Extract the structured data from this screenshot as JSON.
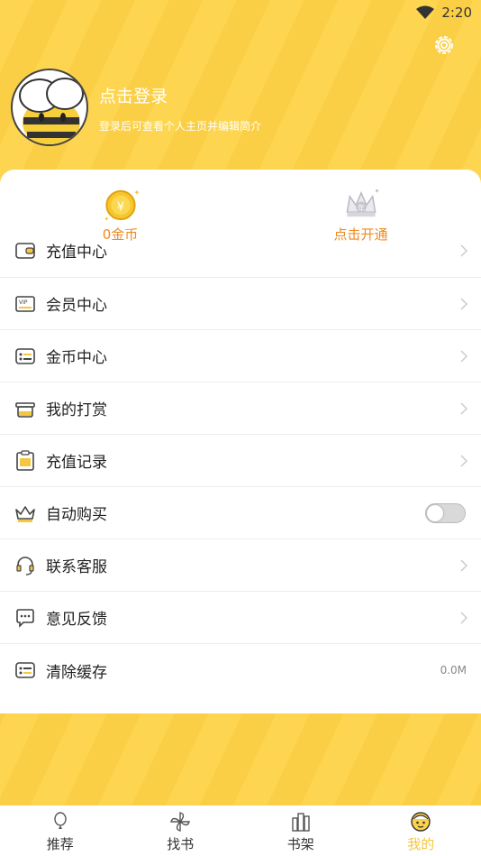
{
  "status_bar": {
    "time": "2:20"
  },
  "profile": {
    "login_title": "点击登录",
    "login_subtitle": "登录后可查看个人主页并编辑简介"
  },
  "quick_actions": [
    {
      "label": "0金币",
      "icon": "gold-coin-icon",
      "coin_symbol": "¥"
    },
    {
      "label": "点击开通",
      "icon": "vip-crown-icon",
      "crown_text": "年"
    }
  ],
  "menu": [
    {
      "label": "充值中心",
      "icon": "wallet-icon"
    },
    {
      "label": "会员中心",
      "icon": "vip-card-icon"
    },
    {
      "label": "金币中心",
      "icon": "coin-list-icon"
    },
    {
      "label": "我的打赏",
      "icon": "gift-box-icon"
    },
    {
      "label": "充值记录",
      "icon": "record-icon"
    },
    {
      "label": "自动购买",
      "icon": "crown-icon",
      "toggle": false
    },
    {
      "label": "联系客服",
      "icon": "headset-icon"
    },
    {
      "label": "意见反馈",
      "icon": "chat-bubble-icon"
    },
    {
      "label": "清除缓存",
      "icon": "cache-icon",
      "value": "0.0M"
    }
  ],
  "tabs": [
    {
      "label": "推荐",
      "icon": "balloon-icon"
    },
    {
      "label": "找书",
      "icon": "pinwheel-icon"
    },
    {
      "label": "书架",
      "icon": "bookshelf-icon"
    },
    {
      "label": "我的",
      "icon": "face-icon",
      "active": true
    }
  ],
  "colors": {
    "accent": "#fcd34e",
    "orange_label": "#f08a1c",
    "active_tab": "#f5c640"
  }
}
